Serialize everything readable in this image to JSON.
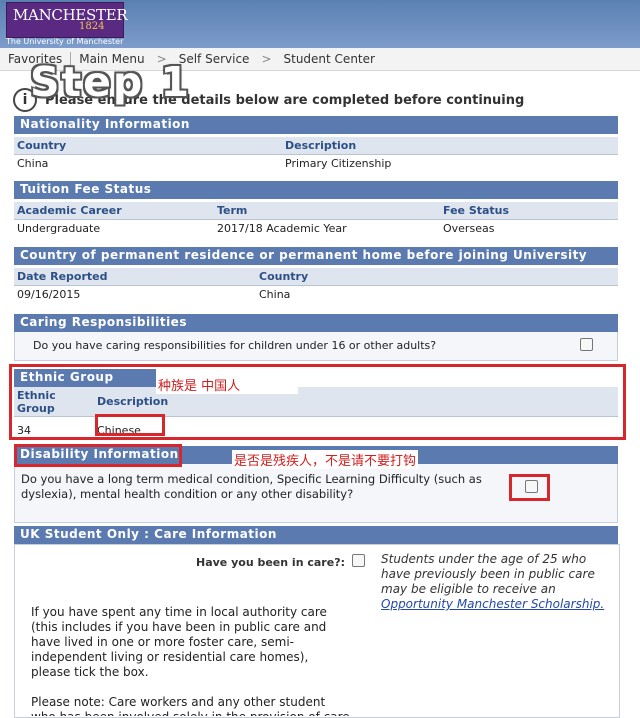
{
  "header": {
    "logo_text": "MANCHESTER",
    "logo_year": "1824",
    "university": "The University of Manchester"
  },
  "nav": {
    "favorites": "Favorites",
    "main_menu": "Main Menu",
    "self_service": "Self Service",
    "student_center": "Student Center",
    "sep": ">"
  },
  "step_label": "Step 1",
  "info": {
    "message": "Please ensure the details below are completed before continuing"
  },
  "nationality": {
    "title": "Nationality Information",
    "col_country": "Country",
    "col_description": "Description",
    "country": "China",
    "description": "Primary Citizenship"
  },
  "tuition": {
    "title": "Tuition Fee Status",
    "col_career": "Academic Career",
    "col_term": "Term",
    "col_fee": "Fee Status",
    "career": "Undergraduate",
    "term": "2017/18 Academic Year",
    "fee": "Overseas"
  },
  "residence": {
    "title": "Country of permanent residence or permanent home before joining University",
    "col_date": "Date Reported",
    "col_country": "Country",
    "date": "09/16/2015",
    "country": "China"
  },
  "caring": {
    "title": "Caring Responsibilities",
    "question": "Do you have caring responsibilities for children under 16 or other adults?"
  },
  "ethnic": {
    "title": "Ethnic Group",
    "col_group": "Ethnic Group",
    "col_description": "Description",
    "group": "34",
    "description": "Chinese",
    "annotation": "种族是 中国人"
  },
  "disability": {
    "title": "Disability Information",
    "question": "Do you have a long term medical condition, Specific Learning Difficulty (such as dyslexia), mental health condition or any other disability?",
    "annotation": "是否是残疾人，不是请不要打钩"
  },
  "uk_care": {
    "title": "UK Student Only : Care Information",
    "question": "Have you been in care?:",
    "note": "Students under the age of 25 who have previously been in public care may be eligible to receive an",
    "link": "Opportunity Manchester Scholarship.",
    "paragraph": "If you have spent any time in local authority care (this includes if you have been in public care and have lived in one or more foster care, semi-independent living or residential care homes), please tick the box.",
    "please_note": "Please note: Care workers and any other student who has been involved solely in the provision of care"
  },
  "colors": {
    "section_header": "#5b7bb0",
    "column_header_text": "#2c4f86",
    "highlight": "#d7262c"
  }
}
